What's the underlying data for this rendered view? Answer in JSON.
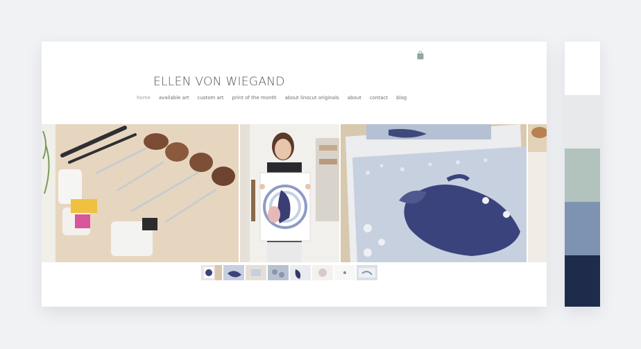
{
  "site": {
    "brand": "ELLEN VON WIEGAND",
    "nav": [
      {
        "label": "home",
        "active": true
      },
      {
        "label": "available art",
        "active": false
      },
      {
        "label": "custom art",
        "active": false
      },
      {
        "label": "print of the month",
        "active": false
      },
      {
        "label": "about linocut originals",
        "active": false
      },
      {
        "label": "about",
        "active": false
      },
      {
        "label": "contact",
        "active": false
      },
      {
        "label": "blog",
        "active": false
      }
    ],
    "cart_icon": "shopping-bag-icon",
    "accent_color": "#93a9a2",
    "gallery": {
      "photos": [
        "carving-tools-and-inks-photo",
        "artist-holding-print-photo",
        "linocut-prints-on-table-photo",
        "partial-table-photo"
      ],
      "thumbnail_count": 8
    }
  },
  "palette": {
    "colors": [
      "#ffffff",
      "#e8e9ea",
      "#b1c3bc",
      "#7d93b1",
      "#1f2b4a"
    ]
  }
}
